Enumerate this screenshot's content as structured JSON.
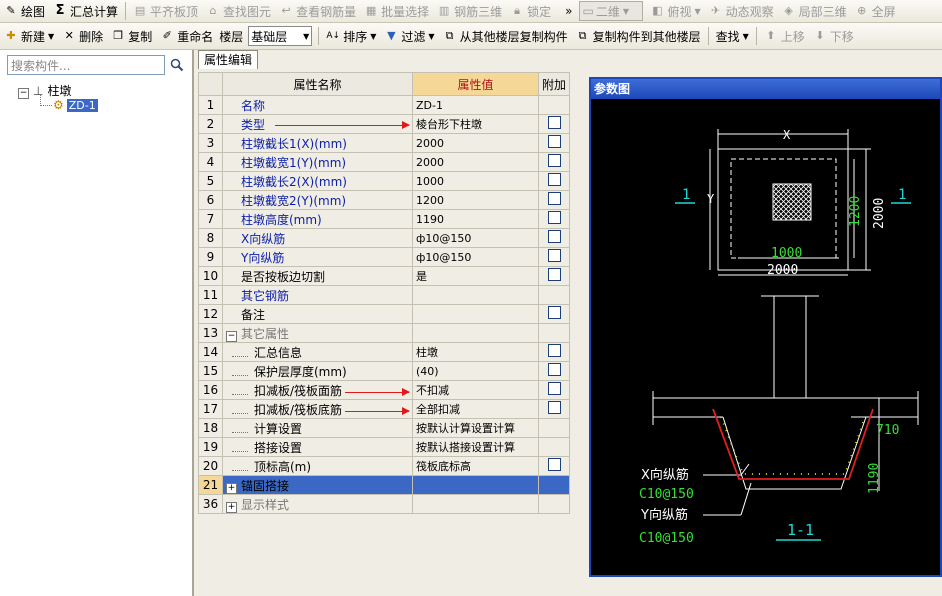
{
  "toolbar1": {
    "items": [
      "绘图",
      "汇总计算",
      "平齐板顶",
      "查找图元",
      "查看钢筋量",
      "批量选择",
      "钢筋三维",
      "锁定"
    ],
    "view_select": "二维",
    "more": [
      "俯视",
      "动态观察",
      "局部三维",
      "全屏"
    ],
    "overflow": "»"
  },
  "toolbar2": {
    "new": "新建",
    "delete": "删除",
    "copy": "复制",
    "rename": "重命名",
    "floor_label": "楼层",
    "floor_value": "基础层",
    "sort": "排序",
    "filter": "过滤",
    "copy_from": "从其他楼层复制构件",
    "copy_to": "复制构件到其他楼层",
    "find": "查找",
    "up": "上移",
    "down": "下移"
  },
  "search": {
    "placeholder": "搜索构件..."
  },
  "tree": {
    "root": "柱墩",
    "child": "ZD-1"
  },
  "tab": "属性编辑",
  "grid": {
    "headers": {
      "name": "属性名称",
      "value": "属性值",
      "extra": "附加"
    },
    "rows": [
      {
        "num": "1",
        "name": "名称",
        "value": "ZD-1",
        "check": false
      },
      {
        "num": "2",
        "name": "类型",
        "value": "棱台形下柱墩",
        "check": true
      },
      {
        "num": "3",
        "name": "柱墩截长1(X)(mm)",
        "value": "2000",
        "check": true
      },
      {
        "num": "4",
        "name": "柱墩截宽1(Y)(mm)",
        "value": "2000",
        "check": true
      },
      {
        "num": "5",
        "name": "柱墩截长2(X)(mm)",
        "value": "1000",
        "check": true
      },
      {
        "num": "6",
        "name": "柱墩截宽2(Y)(mm)",
        "value": "1200",
        "check": true
      },
      {
        "num": "7",
        "name": "柱墩高度(mm)",
        "value": "1190",
        "check": true
      },
      {
        "num": "8",
        "name": "X向纵筋",
        "value": "ф10@150",
        "check": true
      },
      {
        "num": "9",
        "name": "Y向纵筋",
        "value": "ф10@150",
        "check": true
      },
      {
        "num": "10",
        "name": "是否按板边切割",
        "value": "是",
        "check": true
      },
      {
        "num": "11",
        "name": "其它钢筋",
        "value": "",
        "check": false
      },
      {
        "num": "12",
        "name": "备注",
        "value": "",
        "check": true
      },
      {
        "num": "13",
        "name": "其它属性",
        "value": "",
        "check": false
      },
      {
        "num": "14",
        "name": "汇总信息",
        "value": "柱墩",
        "check": true
      },
      {
        "num": "15",
        "name": "保护层厚度(mm)",
        "value": "(40)",
        "check": true
      },
      {
        "num": "16",
        "name": "扣减板/筏板面筋",
        "value": "不扣减",
        "check": true
      },
      {
        "num": "17",
        "name": "扣减板/筏板底筋",
        "value": "全部扣减",
        "check": true
      },
      {
        "num": "18",
        "name": "计算设置",
        "value": "按默认计算设置计算",
        "check": false
      },
      {
        "num": "19",
        "name": "搭接设置",
        "value": "按默认搭接设置计算",
        "check": false
      },
      {
        "num": "20",
        "name": "顶标高(m)",
        "value": "筏板底标高",
        "check": true
      },
      {
        "num": "21",
        "name": "锚固搭接",
        "value": "",
        "check": false
      },
      {
        "num": "36",
        "name": "显示样式",
        "value": "",
        "check": false
      }
    ]
  },
  "ref": {
    "title": "参数图",
    "labels": {
      "x": "X",
      "y": "Y",
      "section_mark": "1",
      "dim_1000": "1000",
      "dim_2000": "2000",
      "dim_1200": "1200",
      "dim_2000v": "2000",
      "dim_710": "710",
      "dim_1190": "1190",
      "x_bar": "X向纵筋",
      "x_bar_spec": "C10@150",
      "y_bar": "Y向纵筋",
      "y_bar_spec": "C10@150",
      "section_title": "1-1"
    },
    "colors": {
      "white": "#ffffff",
      "green": "#33e033",
      "cyan": "#20d8d8",
      "red": "#e02020",
      "yellow": "#e8e020"
    }
  }
}
